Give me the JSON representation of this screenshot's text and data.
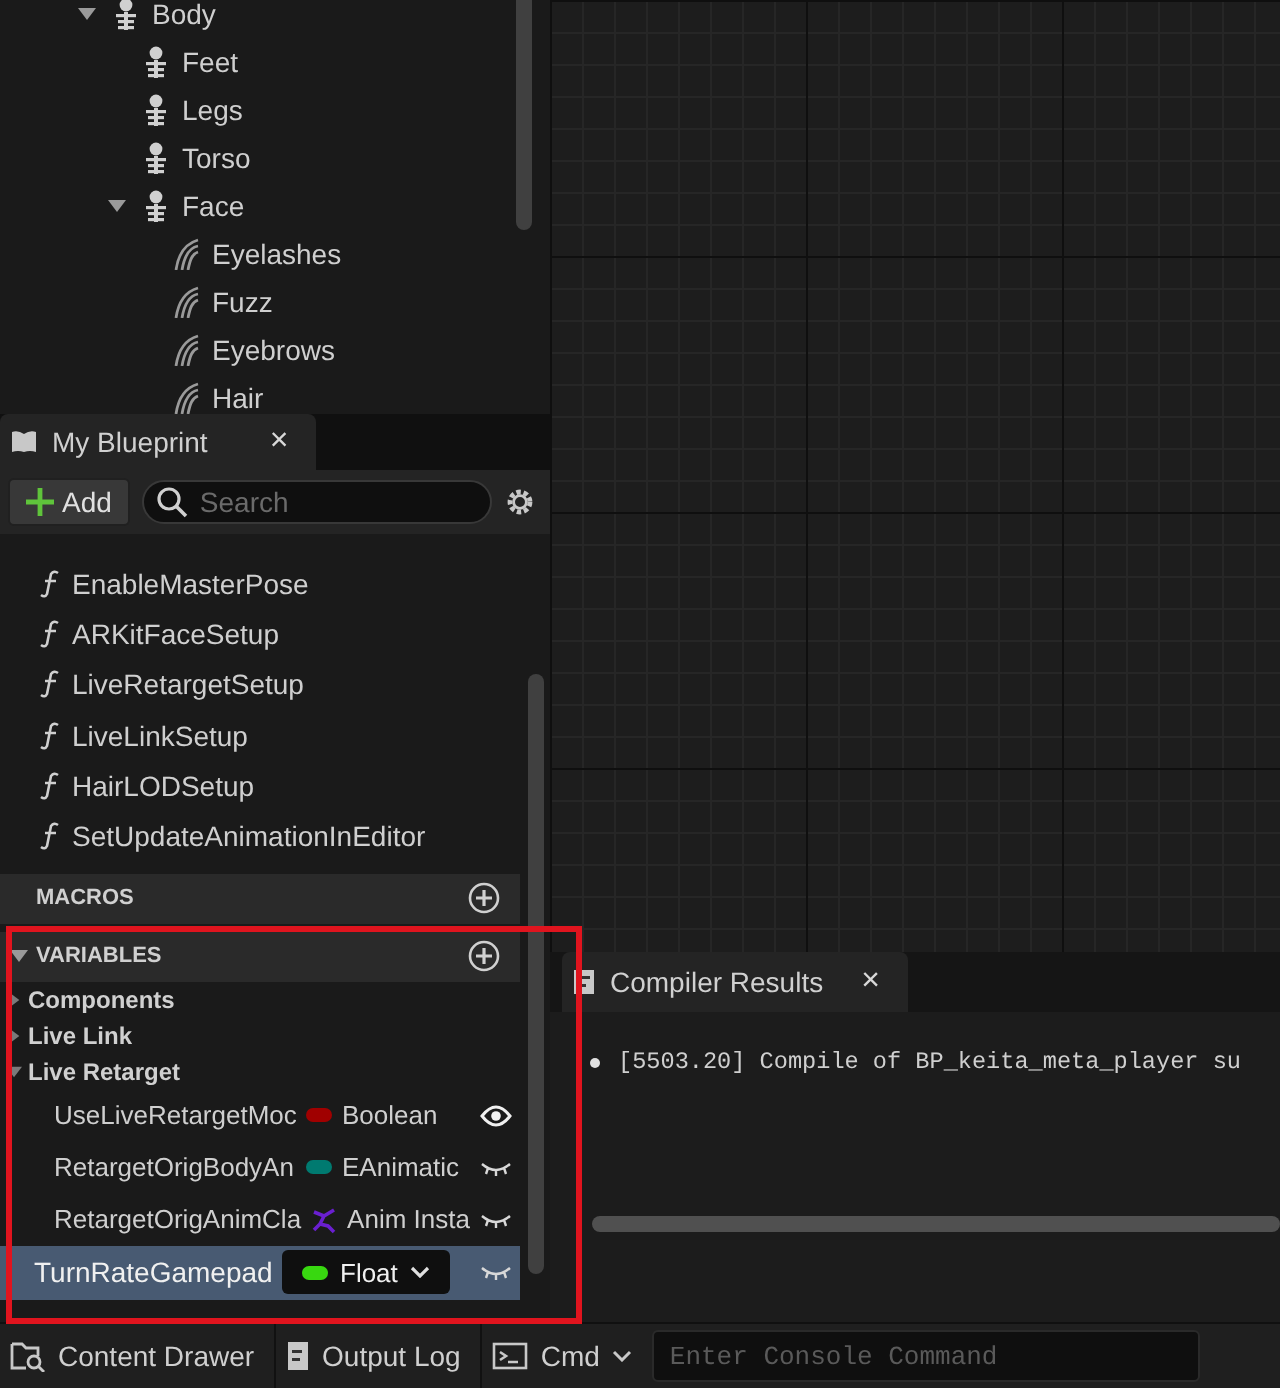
{
  "asset_tree": [
    {
      "label": "Body",
      "kind": "skeleton",
      "expanded": true,
      "children": [
        {
          "label": "Feet",
          "kind": "skeleton"
        },
        {
          "label": "Legs",
          "kind": "skeleton"
        },
        {
          "label": "Torso",
          "kind": "skeleton"
        },
        {
          "label": "Face",
          "kind": "skeleton",
          "expanded": true,
          "children": [
            {
              "label": "Eyelashes",
              "kind": "groom"
            },
            {
              "label": "Fuzz",
              "kind": "groom"
            },
            {
              "label": "Eyebrows",
              "kind": "groom"
            },
            {
              "label": "Hair",
              "kind": "groom"
            }
          ]
        }
      ]
    }
  ],
  "blueprint_tab": {
    "title": "My Blueprint",
    "close": "×"
  },
  "toolbar": {
    "add_button": "Add",
    "search": {
      "placeholder": "Search"
    }
  },
  "functions": [
    "EnableMasterPose",
    "ARKitFaceSetup",
    "LiveRetargetSetup",
    "LiveLinkSetup",
    "HairLODSetup",
    "SetUpdateAnimationInEditor"
  ],
  "macros": {
    "title": "MACROS"
  },
  "variables": {
    "title": "VARIABLES",
    "expanded": true,
    "categories": [
      {
        "label": "Components",
        "expanded": false
      },
      {
        "label": "Live Link",
        "expanded": false
      },
      {
        "label": "Live Retarget",
        "expanded": true,
        "items": [
          {
            "name": "UseLiveRetargetMoc",
            "type": "Boolean",
            "kind": "pill",
            "color": "#a00000",
            "visible": true,
            "selected": false
          },
          {
            "name": "RetargetOrigBodyAn",
            "type": "EAnimatic",
            "kind": "pill",
            "color": "#007a70",
            "visible": false,
            "selected": false
          },
          {
            "name": "RetargetOrigAnimCla",
            "type": "Anim Insta",
            "kind": "class",
            "color": "#6a1fd0",
            "visible": false,
            "selected": false
          },
          {
            "name": "TurnRateGamepad",
            "type": "Float",
            "kind": "pill",
            "color": "#38d810",
            "visible": false,
            "selected": true
          }
        ]
      }
    ]
  },
  "compiler_tab": {
    "title": "Compiler Results",
    "close": "×"
  },
  "compiler_messages": [
    "[5503.20] Compile of BP_keita_meta_player su"
  ],
  "bottom_bar": {
    "content_drawer": "Content Drawer",
    "output_log": "Output Log",
    "cmd": "Cmd",
    "console": {
      "placeholder": "Enter Console Command"
    }
  }
}
